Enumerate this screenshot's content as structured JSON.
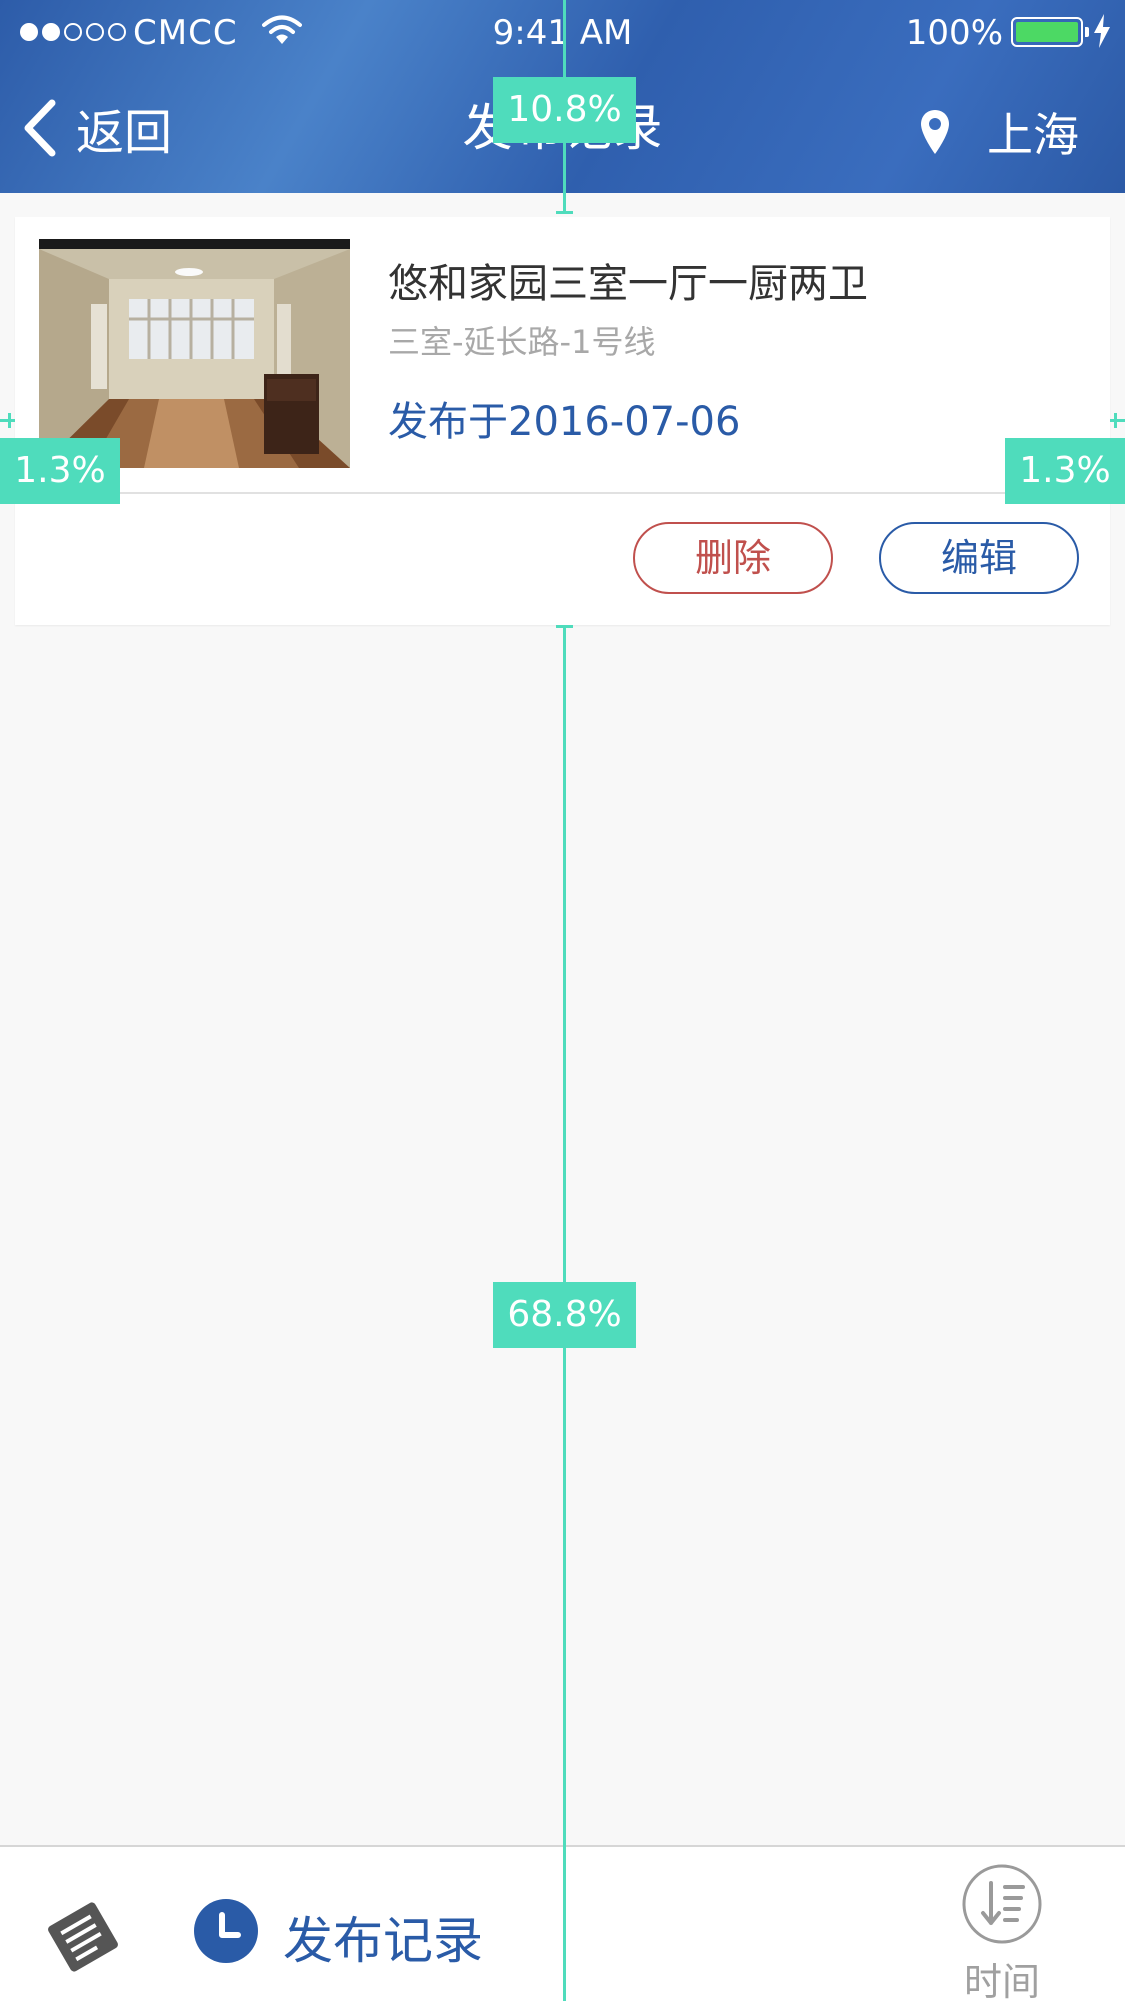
{
  "status_bar": {
    "carrier": "CMCC",
    "time": "9:41 AM",
    "battery": "100%"
  },
  "nav": {
    "back_label": "返回",
    "title": "发布记录",
    "location": "上海"
  },
  "listing": {
    "title": "悠和家园三室一厅一厨两卫",
    "subtitle": "三室-延长路-1号线",
    "date": "发布于2016-07-06",
    "delete_label": "删除",
    "edit_label": "编辑"
  },
  "bottom_bar": {
    "label": "发布记录",
    "sort_label": "时间"
  },
  "measurements": {
    "top_gap": "10.8%",
    "left_margin": "1.3%",
    "right_margin": "1.3%",
    "remaining_height": "68.8%"
  },
  "colors": {
    "primary": "#2a5ba7",
    "delete": "#c0504d",
    "overlay": "#4fdcbc",
    "battery": "#4cd964"
  }
}
